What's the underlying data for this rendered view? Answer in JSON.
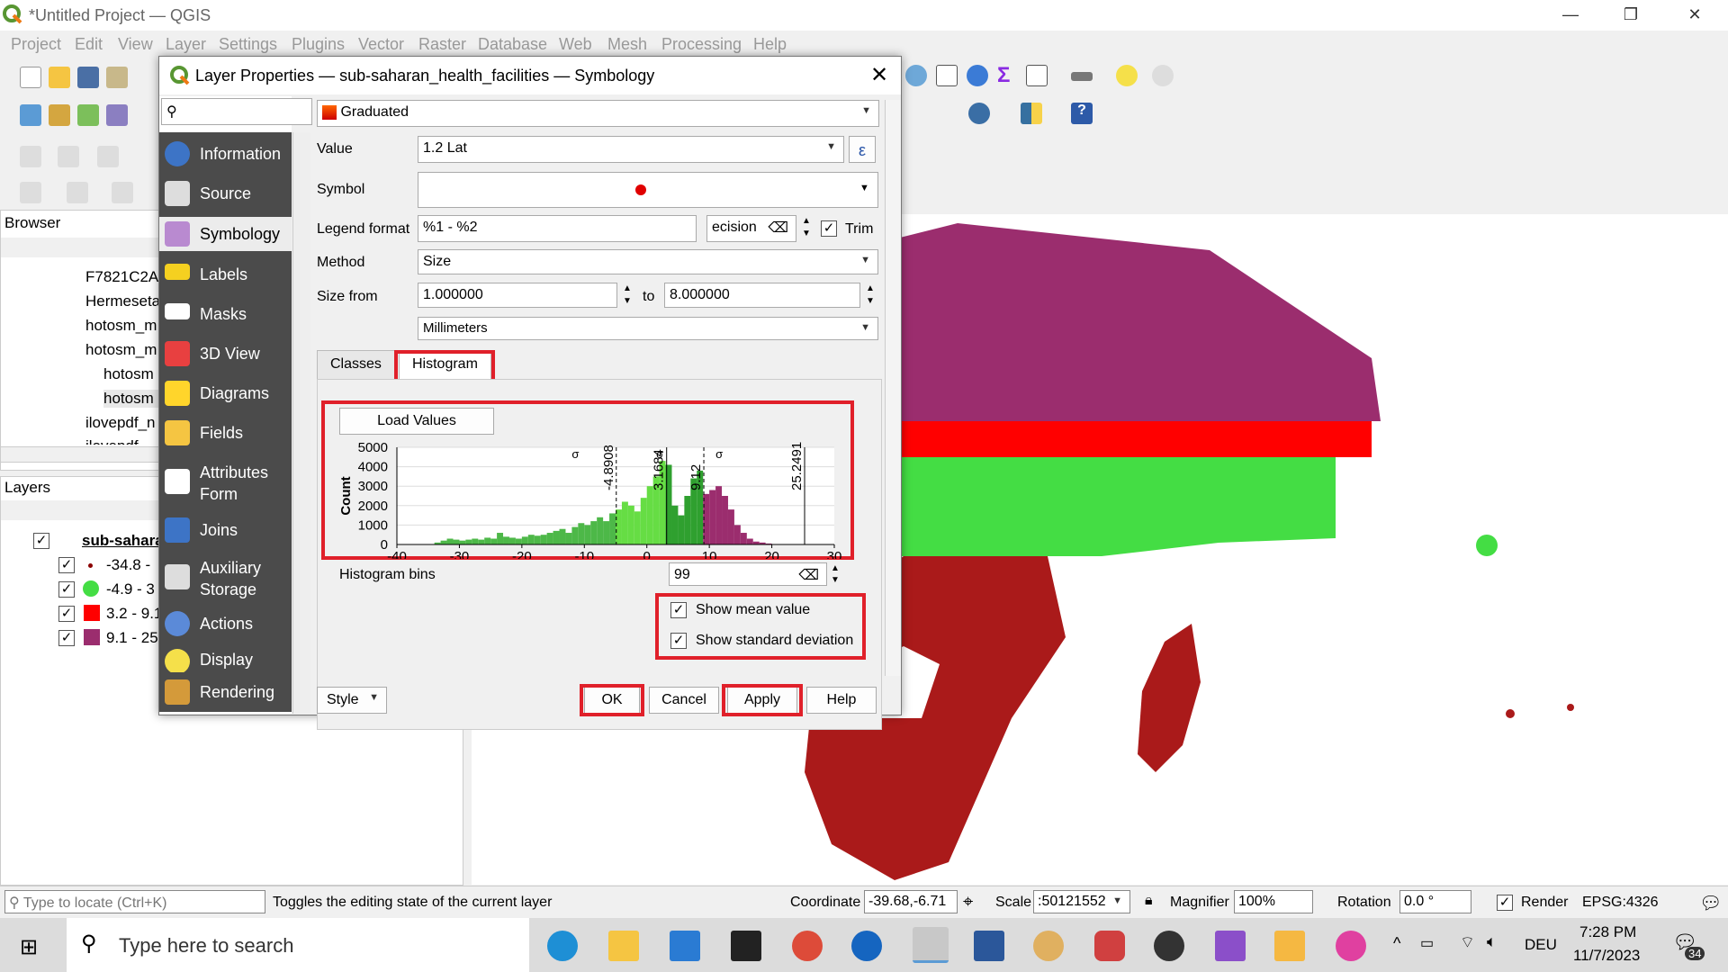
{
  "app": {
    "title": "*Untitled Project — QGIS"
  },
  "menu": [
    "Project",
    "Edit",
    "View",
    "Layer",
    "Settings",
    "Plugins",
    "Vector",
    "Raster",
    "Database",
    "Web",
    "Mesh",
    "Processing",
    "Help"
  ],
  "browser": {
    "header": "Browser",
    "items": [
      "F7821C2A",
      "Hermeseta",
      "hotosm_m",
      "hotosm_m",
      "hotosm",
      "hotosm",
      "ilovepdf_n",
      "ilovepdf"
    ]
  },
  "layers": {
    "header": "Layers",
    "layer_name": "sub-sahara",
    "classes": [
      "-34.8 -",
      "-4.9 - 3",
      "3.2 - 9.1",
      "9.1 - 25"
    ],
    "class_colors": [
      "#8b0000",
      "#44dd44",
      "#ff0000",
      "#9b2d6e"
    ]
  },
  "dialog": {
    "title": "Layer Properties — sub-saharan_health_facilities — Symbology",
    "search_placeholder": "",
    "sidebar": [
      "Information",
      "Source",
      "Symbology",
      "Labels",
      "Masks",
      "3D View",
      "Diagrams",
      "Fields",
      "Attributes Form",
      "Joins",
      "Auxiliary Storage",
      "Actions",
      "Display",
      "Rendering"
    ],
    "renderer": "Graduated",
    "value_label": "Value",
    "value": "1.2 Lat",
    "symbol_label": "Symbol",
    "legend_format_label": "Legend format",
    "legend_format": "%1 - %2",
    "precision": "ecision",
    "trim_label": "Trim",
    "method_label": "Method",
    "method": "Size",
    "size_from_label": "Size from",
    "size_from": "1.000000",
    "to_label": "to",
    "size_to": "8.000000",
    "unit": "Millimeters",
    "tabs": [
      "Classes",
      "Histogram"
    ],
    "load_values": "Load Values",
    "histogram_bins_label": "Histogram bins",
    "histogram_bins": "99",
    "show_mean": "Show mean value",
    "show_stddev": "Show standard deviation",
    "buttons": {
      "style": "Style",
      "ok": "OK",
      "cancel": "Cancel",
      "apply": "Apply",
      "help": "Help"
    }
  },
  "chart_data": {
    "type": "bar",
    "ylabel": "Count",
    "xlim": [
      -40,
      30
    ],
    "ylim": [
      0,
      5000
    ],
    "x_ticks": [
      "-40",
      "-30",
      "-20",
      "-10",
      "0",
      "10",
      "20",
      "30"
    ],
    "y_ticks": [
      "5000",
      "4000",
      "3000",
      "2000",
      "1000",
      "0"
    ],
    "markers": [
      {
        "label": "-4.8908",
        "x": -4.8908
      },
      {
        "label": "3.1684",
        "x": 3.1684
      },
      {
        "label": "9.12",
        "x": 9.12
      },
      {
        "label": "25.2491",
        "x": 25.2491
      }
    ],
    "sigma_labels": [
      "σ",
      "σ",
      "σ"
    ],
    "bins": [
      [
        -34,
        100
      ],
      [
        -33,
        200
      ],
      [
        -32,
        300
      ],
      [
        -31,
        250
      ],
      [
        -30,
        200
      ],
      [
        -29,
        250
      ],
      [
        -28,
        300
      ],
      [
        -27,
        250
      ],
      [
        -26,
        350
      ],
      [
        -25,
        300
      ],
      [
        -24,
        600
      ],
      [
        -23,
        400
      ],
      [
        -22,
        350
      ],
      [
        -21,
        300
      ],
      [
        -20,
        400
      ],
      [
        -19,
        500
      ],
      [
        -18,
        450
      ],
      [
        -17,
        500
      ],
      [
        -16,
        600
      ],
      [
        -15,
        700
      ],
      [
        -14,
        800
      ],
      [
        -13,
        600
      ],
      [
        -12,
        900
      ],
      [
        -11,
        1100
      ],
      [
        -10,
        1000
      ],
      [
        -9,
        1200
      ],
      [
        -8,
        1400
      ],
      [
        -7,
        1200
      ],
      [
        -6,
        1600
      ],
      [
        -5,
        1800
      ],
      [
        -4,
        2200
      ],
      [
        -3,
        2000
      ],
      [
        -2,
        1700
      ],
      [
        -1,
        2400
      ],
      [
        0,
        3000
      ],
      [
        1,
        3500
      ],
      [
        2,
        4300
      ],
      [
        3,
        4100
      ],
      [
        4,
        2000
      ],
      [
        5,
        1500
      ],
      [
        6,
        2500
      ],
      [
        7,
        3400
      ],
      [
        8,
        3800
      ],
      [
        9,
        2600
      ],
      [
        10,
        2800
      ],
      [
        11,
        3000
      ],
      [
        12,
        2500
      ],
      [
        13,
        1800
      ],
      [
        14,
        1000
      ],
      [
        15,
        600
      ],
      [
        16,
        300
      ],
      [
        17,
        150
      ],
      [
        18,
        100
      ],
      [
        19,
        50
      ]
    ],
    "bin_colors": {
      "low": "#4db848",
      "mid": "#66dd44",
      "mid2": "#2fa02f",
      "high": "#9b2d6e"
    }
  },
  "status": {
    "locate_placeholder": "Type to locate (Ctrl+K)",
    "message": "Toggles the editing state of the current layer",
    "coordinate_label": "Coordinate",
    "coordinate": "-39.68,-6.71",
    "scale_label": "Scale",
    "scale": ":50121552",
    "magnifier_label": "Magnifier",
    "magnifier": "100%",
    "rotation_label": "Rotation",
    "rotation": "0.0 °",
    "render_label": "Render",
    "crs": "EPSG:4326",
    "notif": "34"
  },
  "taskbar": {
    "search_placeholder": "Type here to search",
    "lang": "DEU",
    "time": "7:28 PM",
    "date": "11/7/2023"
  }
}
